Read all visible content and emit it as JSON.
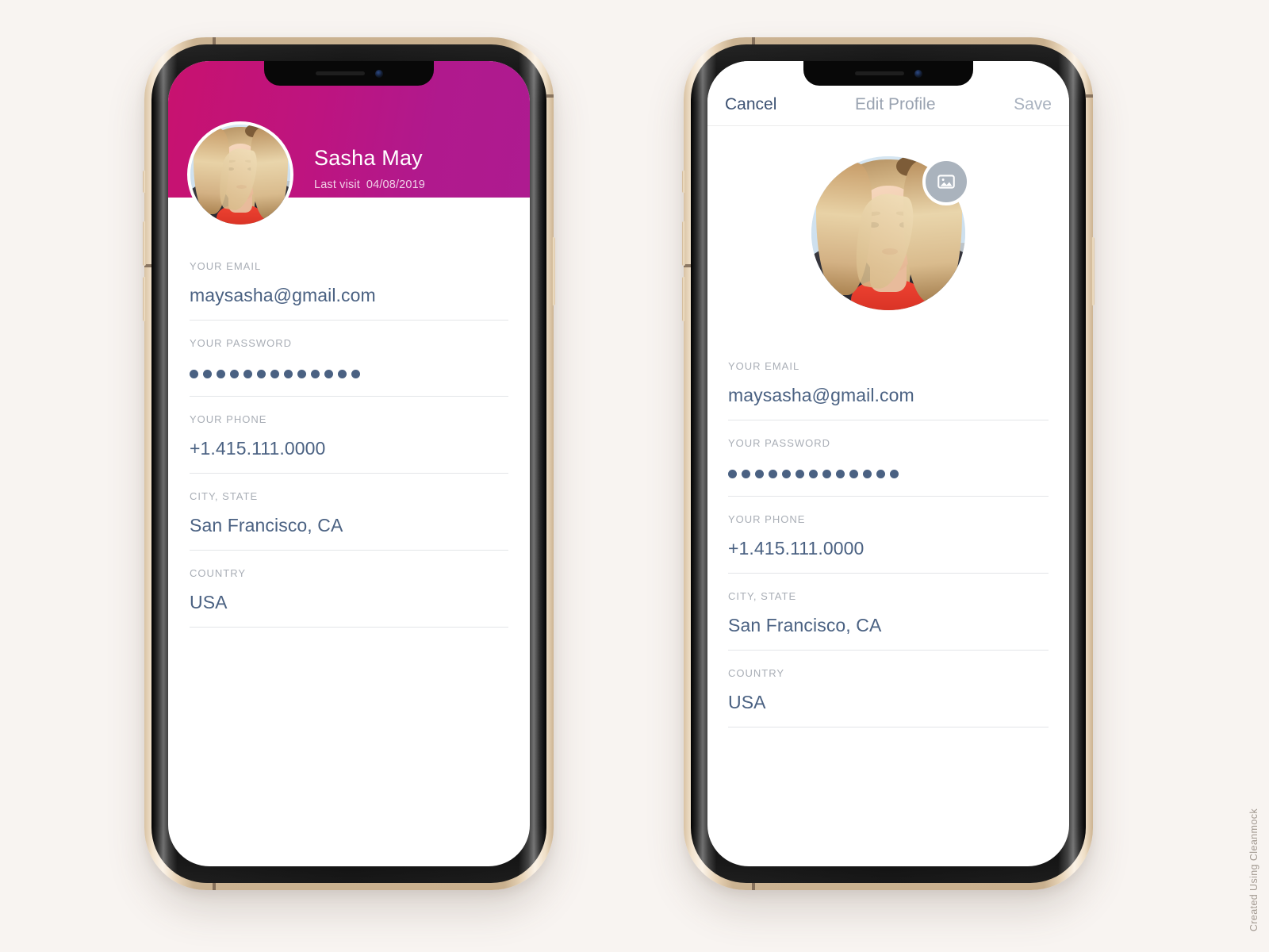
{
  "page": {
    "background_color": "#f8f4f1",
    "watermark": "Created Using Cleanmock"
  },
  "theme": {
    "accent_gradient_start": "#c8126f",
    "accent_gradient_end": "#ae1b90",
    "value_text_color": "#4a6182",
    "label_text_color": "#a9aeb6",
    "divider_color": "#e3e5e8"
  },
  "profile_screen": {
    "hero": {
      "name": "Sasha May",
      "last_visit_label": "Last visit",
      "last_visit_date": "04/08/2019",
      "avatar_alt": "Sasha May profile photo"
    },
    "fields": [
      {
        "label": "YOUR EMAIL",
        "value": "maysasha@gmail.com",
        "type": "email"
      },
      {
        "label": "YOUR PASSWORD",
        "value": "●●●●●●●●●●●●●",
        "type": "password",
        "dot_count": 13
      },
      {
        "label": "YOUR PHONE",
        "value": "+1.415.111.0000",
        "type": "tel"
      },
      {
        "label": "CITY, STATE",
        "value": "San Francisco, CA",
        "type": "text"
      },
      {
        "label": "COUNTRY",
        "value": "USA",
        "type": "text"
      }
    ]
  },
  "edit_screen": {
    "navbar": {
      "cancel_label": "Cancel",
      "title": "Edit Profile",
      "save_label": "Save"
    },
    "avatar": {
      "alt": "Sasha May profile photo",
      "badge_icon": "image-icon"
    },
    "fields": [
      {
        "label": "YOUR EMAIL",
        "value": "maysasha@gmail.com",
        "type": "email"
      },
      {
        "label": "YOUR PASSWORD",
        "value": "●●●●●●●●●●●●●",
        "type": "password",
        "dot_count": 13
      },
      {
        "label": "YOUR PHONE",
        "value": "+1.415.111.0000",
        "type": "tel"
      },
      {
        "label": "CITY, STATE",
        "value": "San Francisco, CA",
        "type": "text"
      },
      {
        "label": "COUNTRY",
        "value": "USA",
        "type": "text"
      }
    ]
  }
}
